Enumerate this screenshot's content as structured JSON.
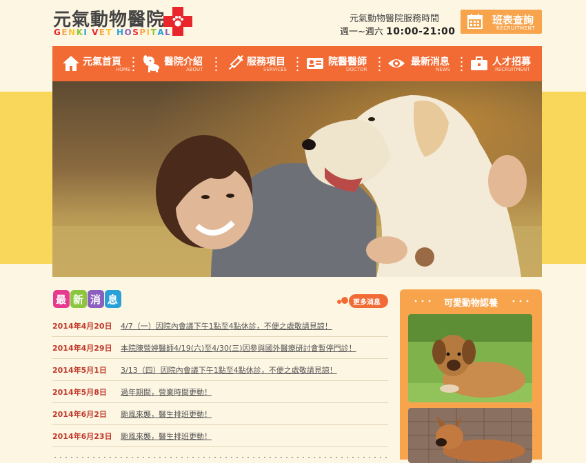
{
  "header": {
    "logo_cn": "元氣動物醫院",
    "logo_en_letters": [
      "G",
      "E",
      "N",
      "K",
      "I",
      " ",
      "V",
      "E",
      "T",
      " ",
      "H",
      "O",
      "S",
      "P",
      "I",
      "T",
      "A",
      "L"
    ],
    "hours_title": "元氣動物醫院服務時間",
    "hours_days": "週一~週六",
    "hours_time": "10:00-21:00",
    "schedule_label": "班表查詢",
    "schedule_sub": "RECRUITMENT"
  },
  "nav": {
    "items": [
      {
        "cn": "元氣首頁",
        "en": "HOME",
        "icon": "home-icon"
      },
      {
        "cn": "醫院介紹",
        "en": "ABOUT",
        "icon": "dog-icon"
      },
      {
        "cn": "服務項目",
        "en": "SERVICES",
        "icon": "syringe-icon"
      },
      {
        "cn": "院醫醫師",
        "en": "DOCTOR",
        "icon": "id-card-icon"
      },
      {
        "cn": "最新消息",
        "en": "NEWS",
        "icon": "eye-icon"
      },
      {
        "cn": "人才招募",
        "en": "RECRUITMENT",
        "icon": "briefcase-icon"
      }
    ]
  },
  "news": {
    "title_chars": [
      "最",
      "新",
      "消",
      "息"
    ],
    "more_label": "更多消息",
    "items": [
      {
        "date": "2014年4月20日",
        "text": "4/7（一）因院內會議下午1點至4點休診，不便之處敬請見諒！"
      },
      {
        "date": "2014年4月29日",
        "text": "本院陳營婷醫師4/19(六)至4/30(三)因參與國外醫療研討會暫停門診！"
      },
      {
        "date": "2014年5月1日",
        "text": "3/13（四）因院內會議下午1點至4點休診，不便之處敬請見諒！"
      },
      {
        "date": "2014年5月8日",
        "text": "過年期間，營業時間更動！"
      },
      {
        "date": "2014年6月2日",
        "text": "颱風來襲，醫生排班更動！"
      },
      {
        "date": "2014年6月23日",
        "text": "颱風來襲，醫生排班更動！"
      }
    ]
  },
  "adoption": {
    "title": "可愛動物認養"
  },
  "colors": {
    "nav_orange": "#f26b34",
    "panel_orange": "#f7a44c",
    "band_yellow": "#f8d75a",
    "date_red": "#c0392b"
  }
}
